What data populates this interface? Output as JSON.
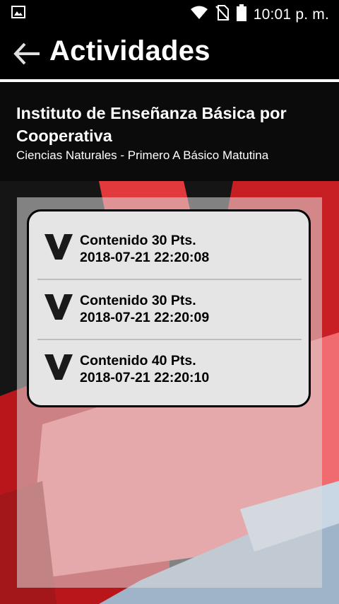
{
  "status_bar": {
    "time": "10:01 p. m.",
    "icons": [
      "image-icon",
      "wifi-icon",
      "no-sim-icon",
      "battery-icon"
    ]
  },
  "app_bar": {
    "title": "Actividades",
    "back_icon": "arrow-left-icon"
  },
  "header": {
    "institution": "Instituto de Enseñanza Básica por Cooperativa",
    "subtitle": "Ciencias Naturales - Primero A Básico Matutina"
  },
  "activities": [
    {
      "title": "Contenido 30 Pts.",
      "timestamp": "2018-07-21 22:20:08",
      "icon": "chevron-down-icon"
    },
    {
      "title": "Contenido 30 Pts.",
      "timestamp": "2018-07-21 22:20:09",
      "icon": "chevron-down-icon"
    },
    {
      "title": "Contenido 40 Pts.",
      "timestamp": "2018-07-21 22:20:10",
      "icon": "chevron-down-icon"
    }
  ],
  "colors": {
    "accent_red": "#e0262b",
    "dark": "#000000",
    "card_bg": "#e5e5e5"
  }
}
